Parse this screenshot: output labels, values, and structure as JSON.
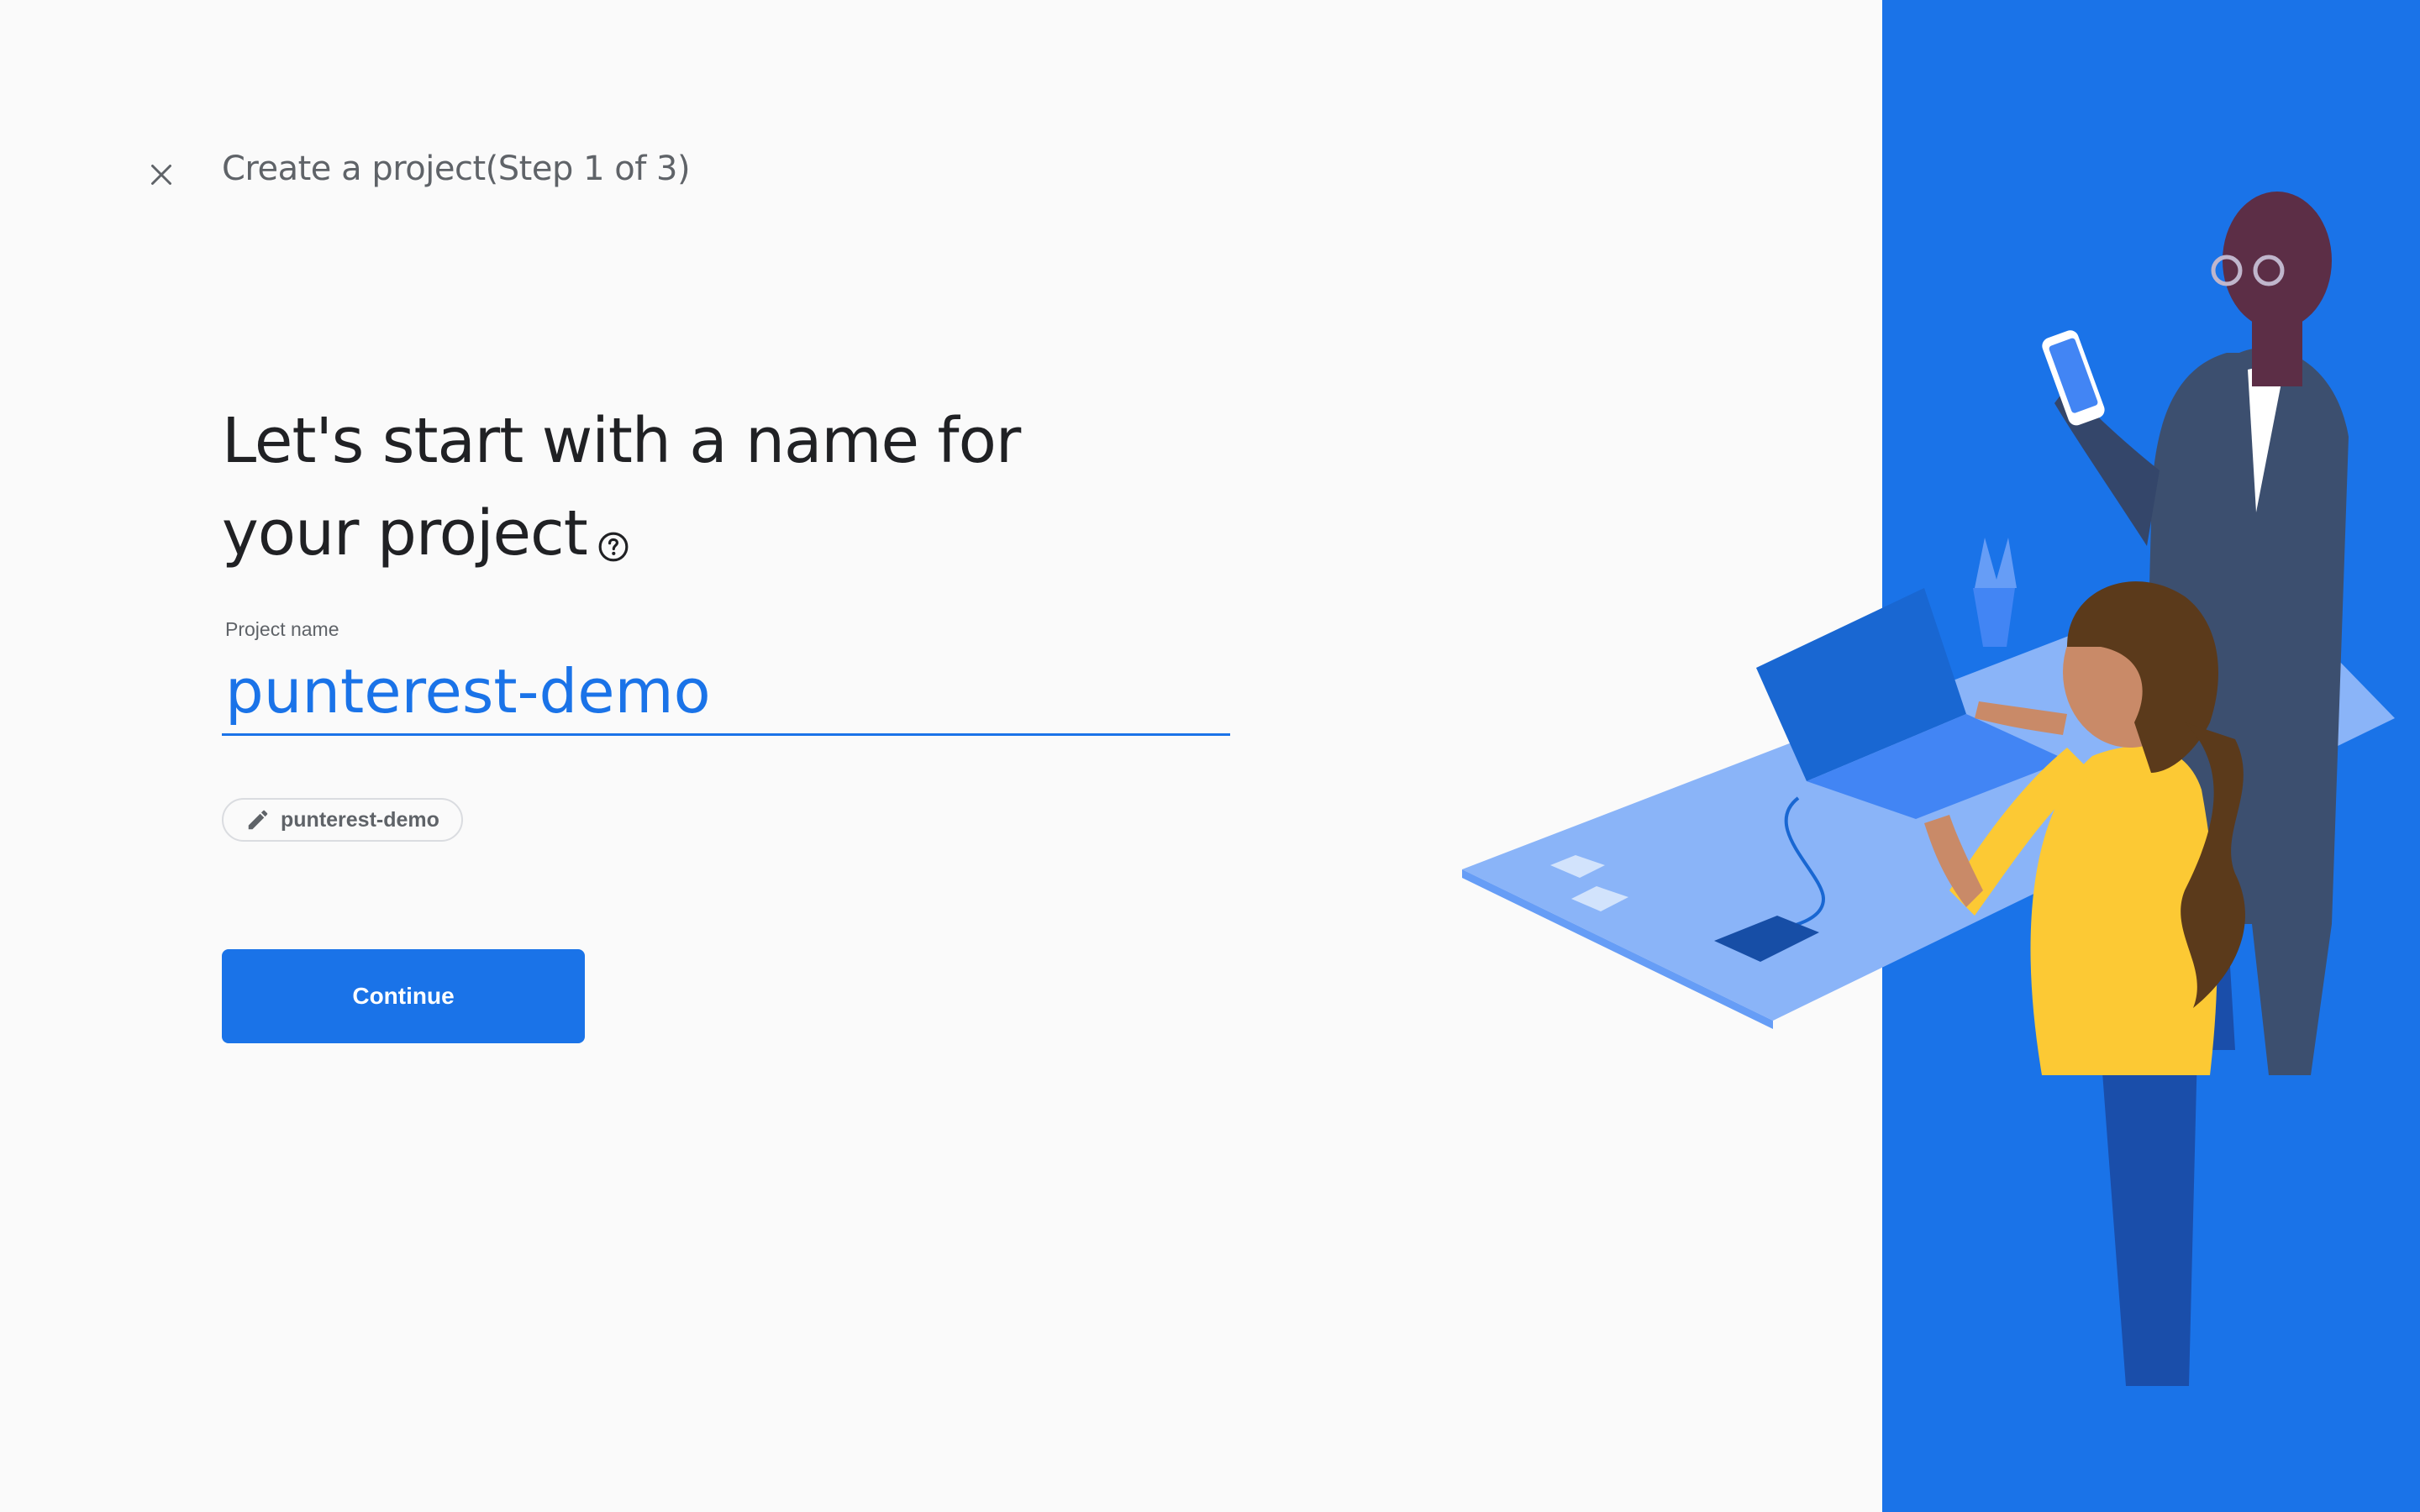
{
  "header": {
    "step_title": "Create a project(Step 1 of 3)"
  },
  "main": {
    "heading_line1": "Let's start with a name for",
    "heading_line2": "your project",
    "project_name_label": "Project name",
    "project_name_value": "punterest-demo",
    "project_id_chip": "punterest-demo",
    "continue_label": "Continue"
  },
  "icons": {
    "close": "close-icon",
    "help": "help-circle-icon",
    "edit": "pencil-icon"
  },
  "colors": {
    "accent": "#1a73e8",
    "background": "#fafafa",
    "panel": "#1a73e8",
    "text_primary": "#202124",
    "text_secondary": "#5f6368"
  }
}
